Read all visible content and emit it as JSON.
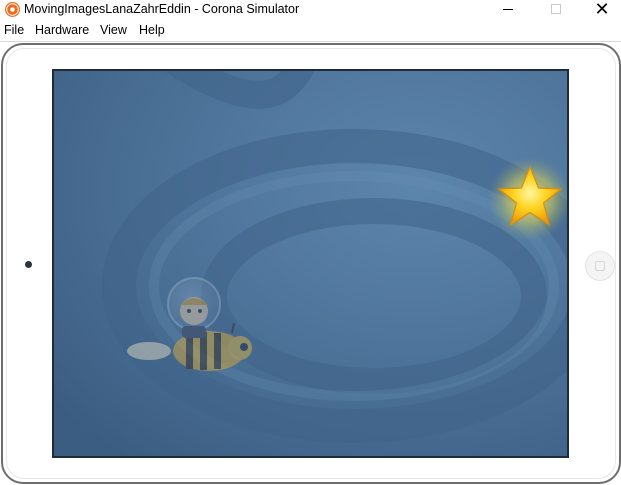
{
  "window": {
    "title": "MovingImagesLanaZahrEddin - Corona Simulator",
    "minimize": "minimize",
    "maximize": "maximize",
    "close": "close"
  },
  "menu": {
    "file": "File",
    "hardware": "Hardware",
    "view": "View",
    "help": "Help"
  },
  "simulator": {
    "device": "tablet",
    "background_color": "#4a6f95",
    "sprites": [
      "bee-character",
      "star"
    ]
  }
}
